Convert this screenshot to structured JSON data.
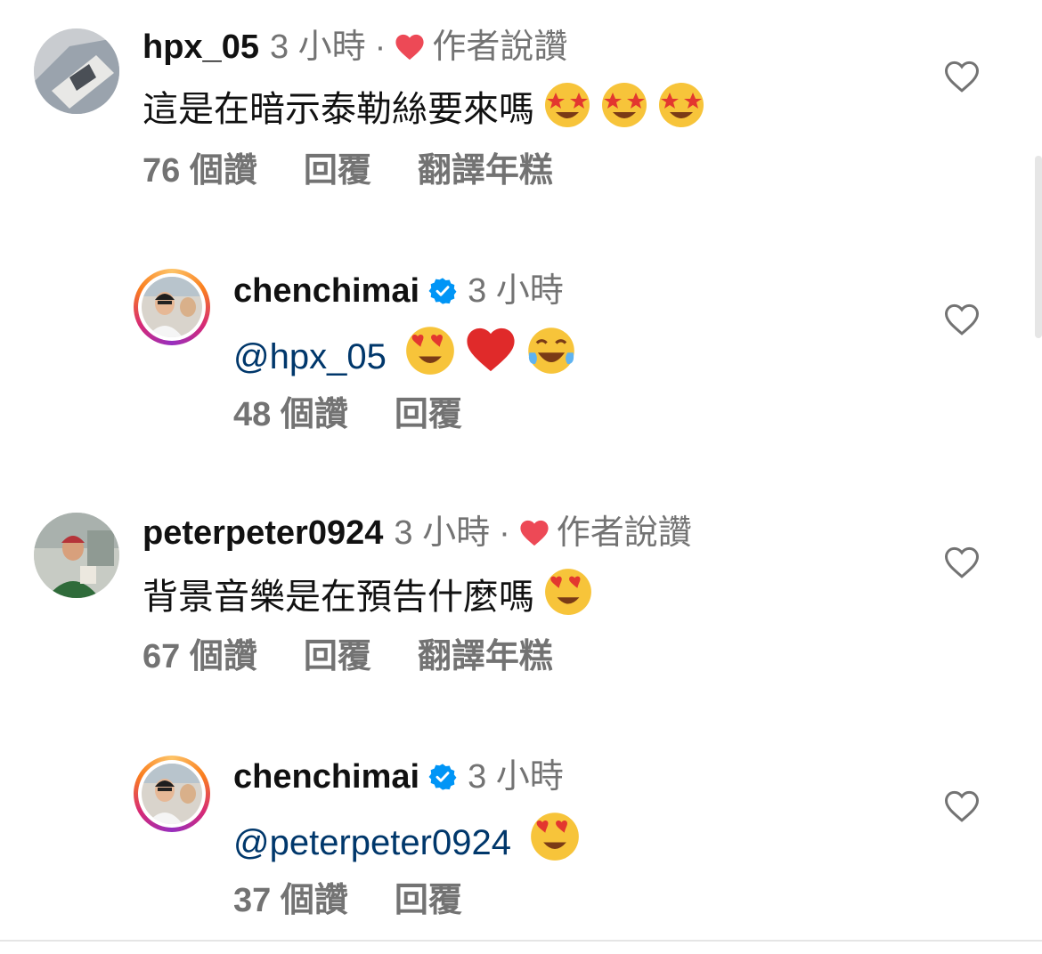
{
  "comments": [
    {
      "username": "hpx_05",
      "time": "3 小時",
      "separator": "·",
      "liked_by_author": "作者說讚",
      "text": "這是在暗示泰勒絲要來嗎",
      "emojis": [
        "star-struck",
        "star-struck",
        "star-struck"
      ],
      "likes": "76 個讚",
      "reply": "回覆",
      "translate": "翻譯年糕"
    },
    {
      "username": "chenchimai",
      "verified": true,
      "time": "3 小時",
      "mention": "@hpx_05",
      "emojis": [
        "heart-eyes",
        "red-heart",
        "tears-of-joy"
      ],
      "likes": "48 個讚",
      "reply": "回覆"
    },
    {
      "username": "peterpeter0924",
      "time": "3 小時",
      "separator": "·",
      "liked_by_author": "作者說讚",
      "text": "背景音樂是在預告什麼嗎",
      "emojis": [
        "heart-eyes"
      ],
      "likes": "67 個讚",
      "reply": "回覆",
      "translate": "翻譯年糕"
    },
    {
      "username": "chenchimai",
      "verified": true,
      "time": "3 小時",
      "mention": "@peterpeter0924",
      "emojis": [
        "heart-eyes"
      ],
      "likes": "37 個讚",
      "reply": "回覆"
    }
  ],
  "colors": {
    "secondary_text": "#737373",
    "mention": "#00376b",
    "author_heart": "#ed4956",
    "verified_badge": "#0095f6"
  }
}
